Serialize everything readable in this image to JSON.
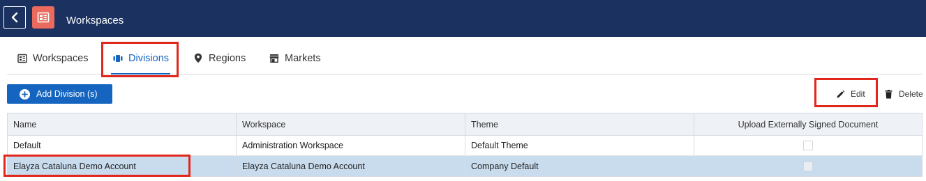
{
  "header": {
    "title": "Workspaces",
    "back_icon": "chevron-left-icon",
    "app_icon": "workspace-icon",
    "app_icon_color": "#ea6b5e",
    "bar_color": "#1b3160"
  },
  "tabs": [
    {
      "label": "Workspaces",
      "icon": "workspace-icon",
      "active": false
    },
    {
      "label": "Divisions",
      "icon": "divisions-icon",
      "active": true
    },
    {
      "label": "Regions",
      "icon": "map-pin-icon",
      "active": false
    },
    {
      "label": "Markets",
      "icon": "store-icon",
      "active": false
    }
  ],
  "toolbar": {
    "add_label": "Add Division (s)",
    "edit_label": "Edit",
    "delete_label": "Delete",
    "accent_color": "#1565c0"
  },
  "table": {
    "columns": [
      "Name",
      "Workspace",
      "Theme",
      "Upload Externally Signed Document"
    ],
    "rows": [
      {
        "name": "Default",
        "workspace": "Administration Workspace",
        "theme": "Default Theme",
        "upload_signed": false,
        "selected": false
      },
      {
        "name": "Elayza Cataluna Demo Account",
        "workspace": "Elayza Cataluna Demo Account",
        "theme": "Company Default",
        "upload_signed": false,
        "selected": true
      }
    ]
  },
  "highlight_color": "#e1261c"
}
